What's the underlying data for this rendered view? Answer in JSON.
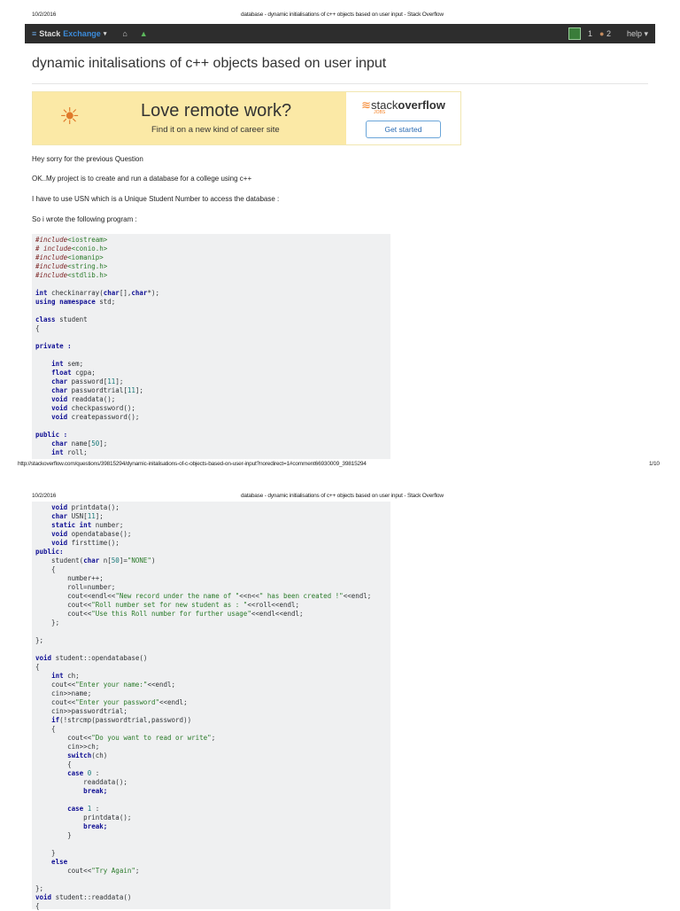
{
  "print_header": {
    "date": "10/2/2016",
    "doc_title": "database - dynamic initialisations of c++ objects based on user input - Stack Overflow"
  },
  "print_footer": {
    "url": "http://stackoverflow.com/questions/39815294/dynamic-initalisations-of-c-objects-based-on-user-input?noredirect=1#comment66930009_39815294",
    "page": "1/10"
  },
  "navbar": {
    "brand_a": "Stack",
    "brand_b": "Exchange",
    "reputation": "1",
    "badge_count": "2",
    "help": "help ▾"
  },
  "question": {
    "title": "dynamic initalisations of c++ objects based on user input"
  },
  "ad": {
    "headline": "Love remote work?",
    "subline": "Find it on a new kind of career site",
    "brand_a": "stack",
    "brand_b": "overflow",
    "jobs": "JOBS",
    "cta": "Get started"
  },
  "body": {
    "paragraphs": [
      "Hey sorry for the previous Question",
      "OK..My project is to create and run a database for a college using c++",
      "I have to use USN which is a Unique Student Number to access the database :",
      "So i wrote the following program :"
    ]
  },
  "code_page1": [
    "#include<iostream>",
    "# include<conio.h>",
    "#include<iomanip>",
    "#include<string.h>",
    "#include<stdlib.h>",
    "",
    "int checkinarray(char[],char*);",
    "using namespace std;",
    "",
    "class student",
    "{",
    "",
    "private :",
    "",
    "    int sem;",
    "    float cgpa;",
    "    char password[11];",
    "    char passwordtrial[11];",
    "    void readdata();",
    "    void checkpassword();",
    "    void createpassword();",
    "",
    "public :",
    "    char name[50];",
    "    int roll;"
  ],
  "code_page2": [
    "    void printdata();",
    "    char USN[11];",
    "    static int number;",
    "    void opendatabase();",
    "    void firsttime();",
    "public:",
    "    student(char n[50]=\"NONE\")",
    "    {",
    "        number++;",
    "        roll=number;",
    "        cout<<endl<<\"New record under the name of \"<<n<<\" has been created !\"<<endl;",
    "        cout<<\"Roll number set for new student as : \"<<roll<<endl;",
    "        cout<<\"Use this Roll number for further usage\"<<endl<<endl;",
    "    };",
    "",
    "};",
    "",
    "void student::opendatabase()",
    "{",
    "    int ch;",
    "    cout<<\"Enter your name:\"<<endl;",
    "    cin>>name;",
    "    cout<<\"Enter your password\"<<endl;",
    "    cin>>passwordtrial;",
    "    if(!strcmp(passwordtrial,password))",
    "    {",
    "        cout<<\"Do you want to read or write\";",
    "        cin>>ch;",
    "        switch(ch)",
    "        {",
    "        case 0 :",
    "            readdata();",
    "            break;",
    "",
    "        case 1 :",
    "            printdata();",
    "            break;",
    "        }",
    "",
    "    }",
    "    else",
    "        cout<<\"Try Again\";",
    "",
    "};",
    "void student::readdata()",
    "{"
  ]
}
